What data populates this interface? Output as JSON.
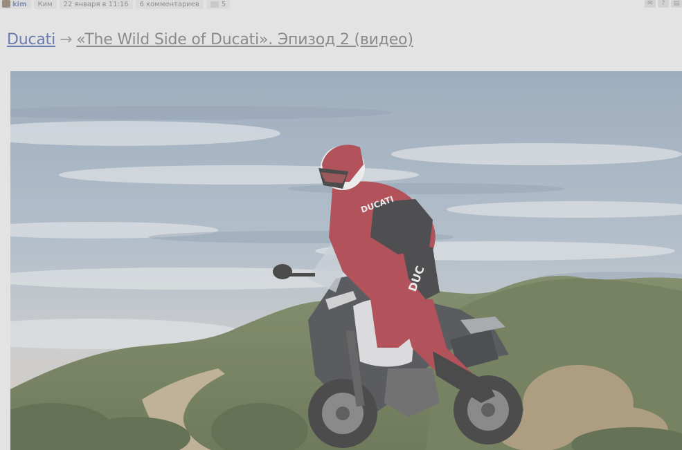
{
  "meta": {
    "username": "kim",
    "author": "Ким",
    "date": "22 января в 11:16",
    "comments": "6 комментариев",
    "flag_count": "5",
    "tools": [
      "✉",
      "?",
      "▤"
    ]
  },
  "post": {
    "blog": "Ducati",
    "arrow": "→",
    "title": "«The Wild Side of Ducati». Эпизод 2 (видео)"
  },
  "image": {
    "subject": "Ducati Multistrada motorcycle rider off-road",
    "jersey_text": "DUCATI",
    "pants_text": "DUC"
  }
}
